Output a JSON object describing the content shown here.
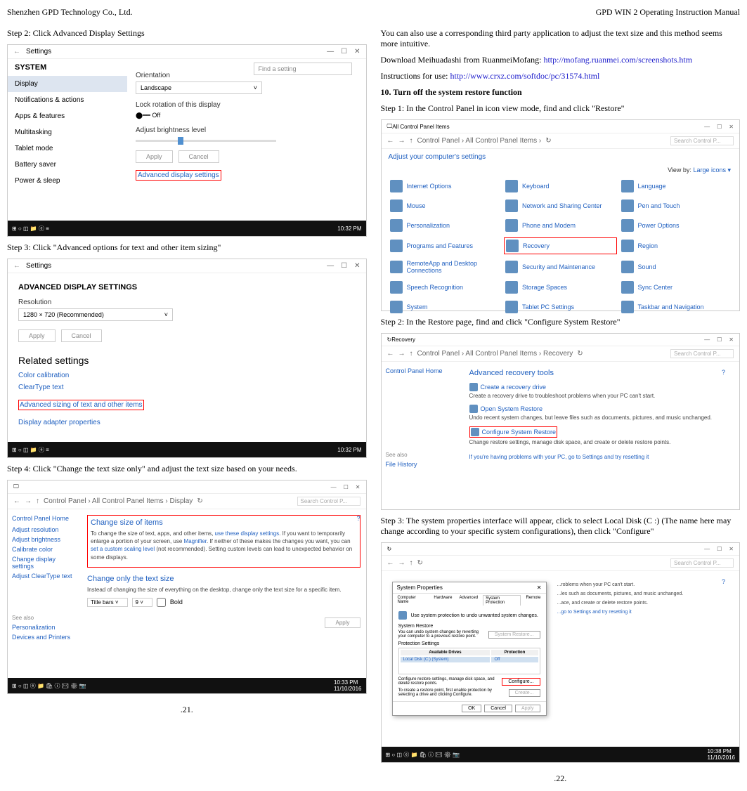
{
  "header": {
    "company": "Shenzhen GPD Technology Co., Ltd.",
    "manual": "GPD WIN 2 Operating Instruction Manual"
  },
  "left": {
    "step2_title": "Step 2: Click Advanced Display Settings",
    "step3_title": "Step 3: Click \"Advanced options for text and other item sizing\"",
    "step4_title": "Step 4: Click \"Change the text size only\" and adjust the text size based on your needs.",
    "page_num": ".21."
  },
  "right": {
    "intro1": "You can also use a corresponding third party application to adjust the text size and this method seems more intuitive.",
    "intro2_pre": "Download Meihuadashi from RuanmeiMofang: ",
    "link1": "http://mofang.ruanmei.com/screenshots.htm",
    "intro3_pre": "Instructions for use: ",
    "link2": "http://www.crxz.com/softdoc/pc/31574.html",
    "section10": "10. Turn off the system restore function",
    "step1": "Step 1: In the Control Panel in icon view mode, find and click \"Restore\"",
    "step2": "Step 2: In the Restore page, find and click \"Configure System Restore\"",
    "step3": "Step 3: The system properties interface will appear, click to select Local Disk (C :) (The name here may change according to your specific system configurations), then click \"Configure\"",
    "page_num": ".22."
  },
  "ss1": {
    "settings": "Settings",
    "system": "SYSTEM",
    "search_placeholder": "Find a setting",
    "sidebar": [
      "Display",
      "Notifications & actions",
      "Apps & features",
      "Multitasking",
      "Tablet mode",
      "Battery saver",
      "Power & sleep"
    ],
    "orientation_label": "Orientation",
    "orientation_value": "Landscape",
    "lock_label": "Lock rotation of this display",
    "toggle_state": "Off",
    "brightness_label": "Adjust brightness level",
    "apply": "Apply",
    "cancel": "Cancel",
    "adv_link": "Advanced display settings",
    "time": "10:32 PM"
  },
  "ss2": {
    "settings": "Settings",
    "title": "ADVANCED DISPLAY SETTINGS",
    "resolution_label": "Resolution",
    "resolution_value": "1280 × 720 (Recommended)",
    "apply": "Apply",
    "cancel": "Cancel",
    "related": "Related settings",
    "links": [
      "Color calibration",
      "ClearType text",
      "Advanced sizing of text and other items",
      "Display adapter properties"
    ],
    "time": "10:32 PM"
  },
  "ss3": {
    "breadcrumb": "Control Panel › All Control Panel Items › Display",
    "search_placeholder": "Search Control P...",
    "side_home": "Control Panel Home",
    "side_links": [
      "Adjust resolution",
      "Adjust brightness",
      "Calibrate color",
      "Change display settings",
      "Adjust ClearType text"
    ],
    "see_also": "See also",
    "see_also_links": [
      "Personalization",
      "Devices and Printers"
    ],
    "change_title": "Change size of items",
    "change_text": "To change the size of text, apps, and other items, ",
    "change_link1": "use these display settings",
    "change_text2": ". If you want to temporarily enlarge a portion of your screen, use ",
    "change_link2": "Magnifier",
    "change_text3": ". If neither of these makes the changes you want, you can ",
    "change_link3": "set a custom scaling level",
    "change_text4": " (not recommended). Setting custom levels can lead to unexpected behavior on some displays.",
    "change_only_title": "Change only the text size",
    "change_only_text": "Instead of changing the size of everything on the desktop, change only the text size for a specific item.",
    "select1": "Title bars",
    "select2": "9",
    "bold": "Bold",
    "apply": "Apply",
    "time": "10:33 PM",
    "date": "11/10/2016"
  },
  "ss4": {
    "title": "All Control Panel Items",
    "breadcrumb": "Control Panel › All Control Panel Items ›",
    "search_placeholder": "Search Control P...",
    "adjust": "Adjust your computer's settings",
    "viewby_label": "View by:",
    "viewby_value": "Large icons ▾",
    "items": [
      "Internet Options",
      "Keyboard",
      "Language",
      "Mouse",
      "Network and Sharing Center",
      "Pen and Touch",
      "Personalization",
      "Phone and Modem",
      "Power Options",
      "Programs and Features",
      "Recovery",
      "Region",
      "RemoteApp and Desktop Connections",
      "Security and Maintenance",
      "Sound",
      "Speech Recognition",
      "Storage Spaces",
      "Sync Center",
      "System",
      "Tablet PC Settings",
      "Taskbar and Navigation"
    ],
    "highlighted_index": 10
  },
  "ss5": {
    "title": "Recovery",
    "breadcrumb": "Control Panel › All Control Panel Items › Recovery",
    "search_placeholder": "Search Control P...",
    "side_home": "Control Panel Home",
    "tools_title": "Advanced recovery tools",
    "items": [
      {
        "t": "Create a recovery drive",
        "d": "Create a recovery drive to troubleshoot problems when your PC can't start."
      },
      {
        "t": "Open System Restore",
        "d": "Undo recent system changes, but leave files such as documents, pictures, and music unchanged."
      },
      {
        "t": "Configure System Restore",
        "d": "Change restore settings, manage disk space, and create or delete restore points."
      }
    ],
    "highlighted_index": 2,
    "note": "If you're having problems with your PC, go to Settings and try resetting it",
    "see_also": "See also",
    "file_history": "File History"
  },
  "ss6": {
    "dialog_title": "System Properties",
    "tabs": [
      "Computer Name",
      "Hardware",
      "Advanced",
      "System Protection",
      "Remote"
    ],
    "active_tab": 3,
    "icon_text": "Use system protection to undo unwanted system changes.",
    "sr_label": "System Restore",
    "sr_text": "You can undo system changes by reverting your computer to a previous restore point.",
    "sr_btn": "System Restore...",
    "ps_label": "Protection Settings",
    "th_drive": "Available Drives",
    "th_prot": "Protection",
    "td_drive": "Local Disk (C:) (System)",
    "td_prot": "Off",
    "cfg_text": "Configure restore settings, manage disk space, and delete restore points.",
    "cfg_btn": "Configure...",
    "create_text": "To create a restore point, first enable protection by selecting a drive and clicking Configure.",
    "create_btn": "Create...",
    "ok": "OK",
    "cancel": "Cancel",
    "apply": "Apply",
    "bg_items": [
      "...roblems when your PC can't start.",
      "...les such as documents, pictures, and music unchanged.",
      "...ace, and create or delete restore points.",
      "...go to Settings and try resetting it"
    ],
    "time": "10:38 PM",
    "date": "11/10/2016"
  }
}
